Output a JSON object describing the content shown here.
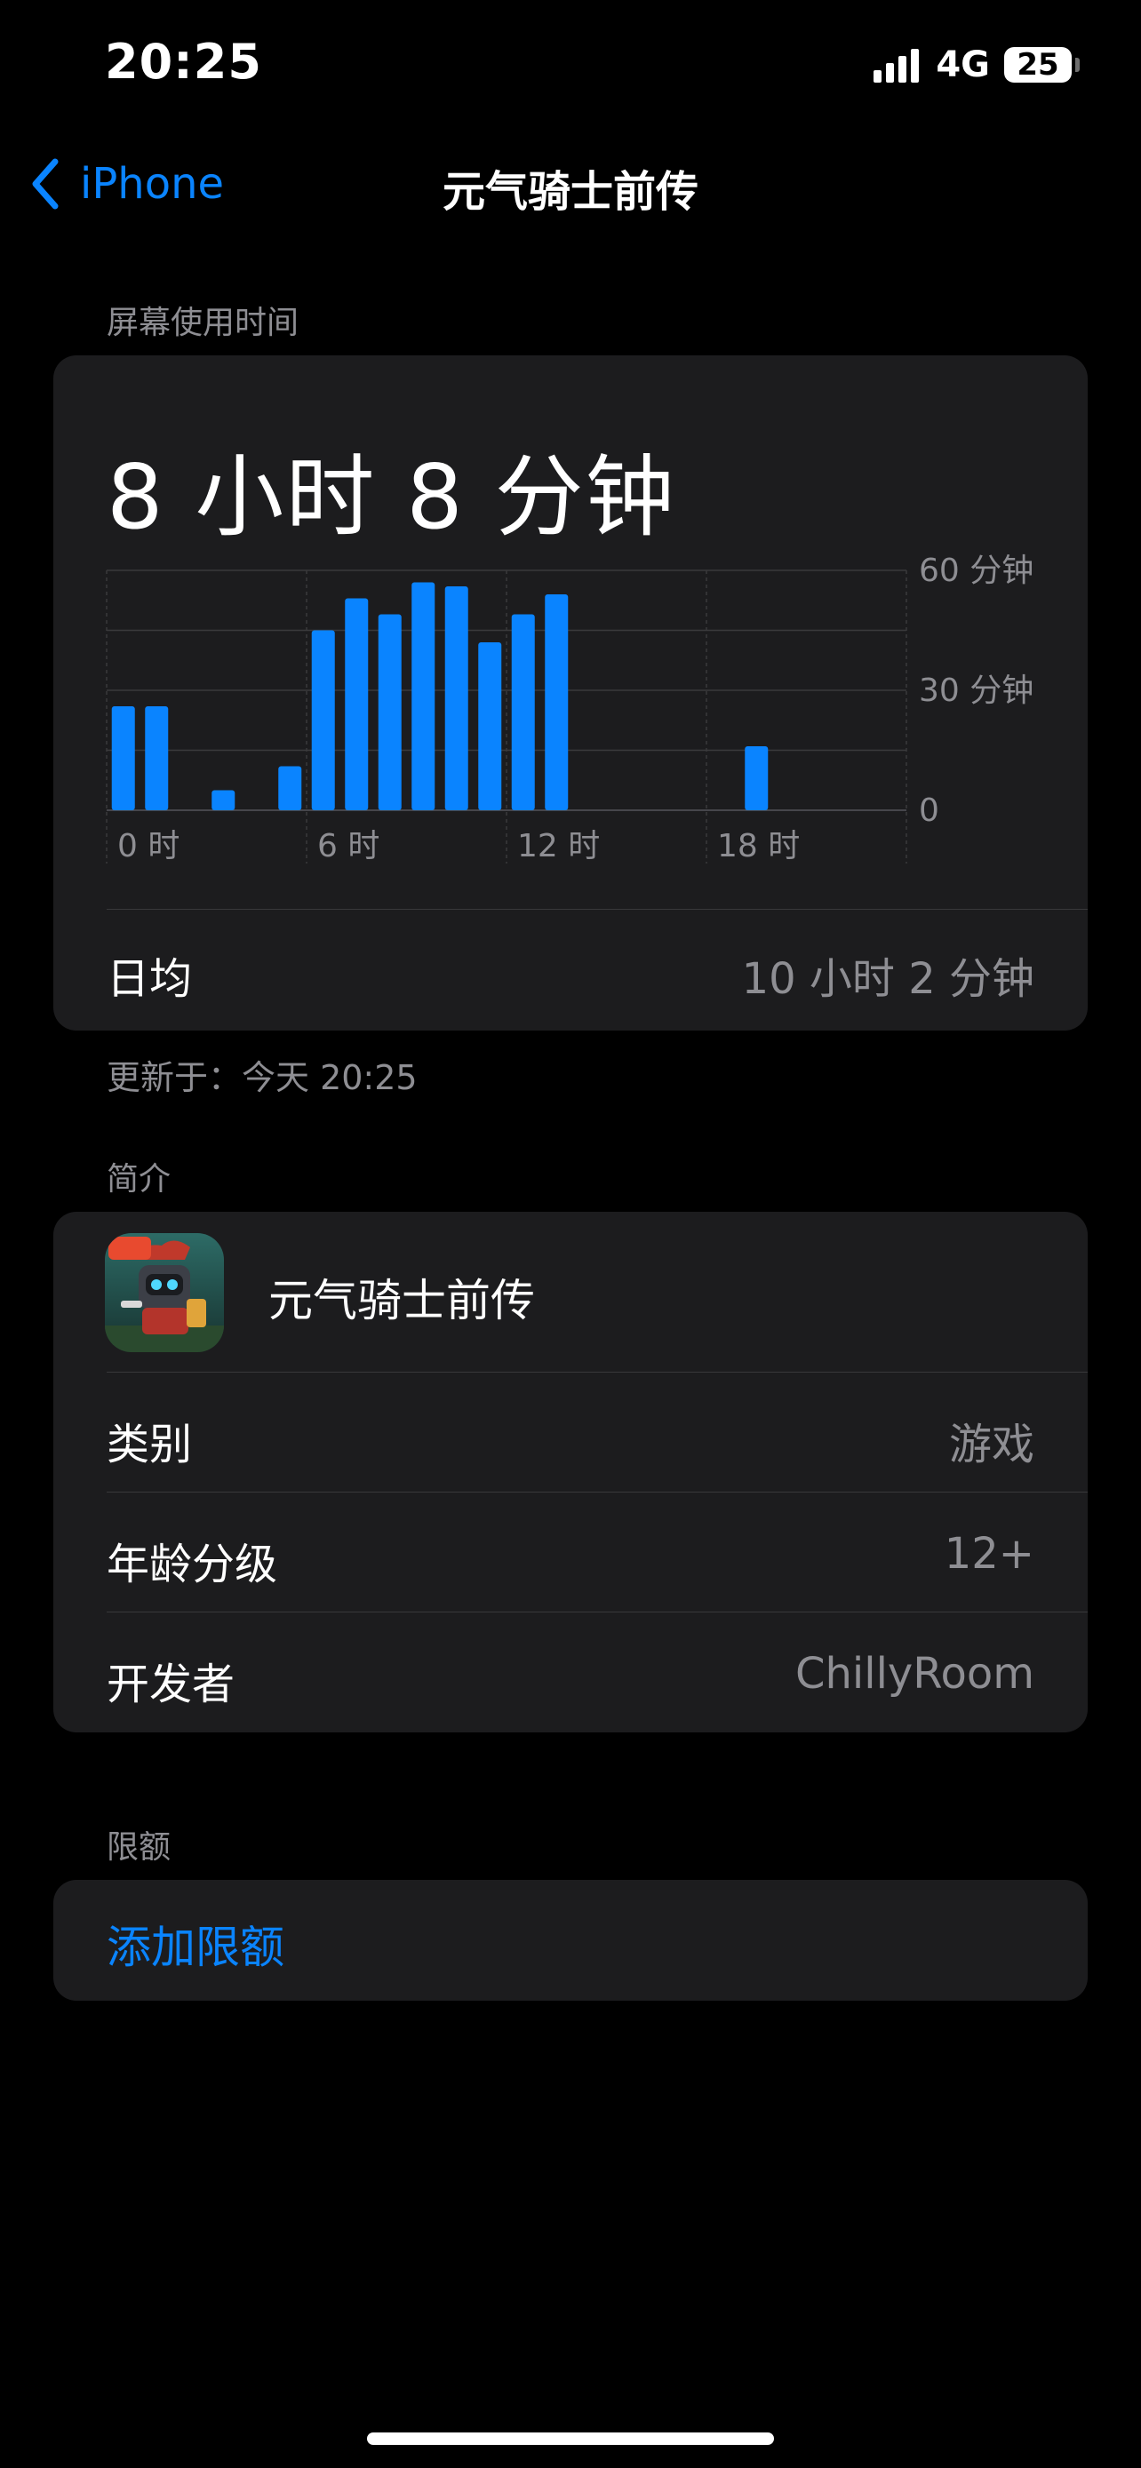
{
  "status_bar": {
    "time": "20:25",
    "network": "4G",
    "battery": "25",
    "signal_bars": 4
  },
  "nav": {
    "back_label": "iPhone",
    "title": "元气骑士前传"
  },
  "screen_time": {
    "section_title": "屏幕使用时间",
    "total": "8 小时 8 分钟",
    "daily_avg_label": "日均",
    "daily_avg_value": "10 小时 2 分钟",
    "updated": "更新于：今天 20:25"
  },
  "chart_data": {
    "type": "bar",
    "x": [
      0,
      1,
      3,
      5,
      6,
      7,
      8,
      9,
      10,
      11,
      12,
      13,
      19
    ],
    "values": [
      26,
      26,
      5,
      11,
      45,
      53,
      49,
      57,
      56,
      42,
      49,
      54,
      16
    ],
    "x_range": [
      0,
      24
    ],
    "x_tick_values": [
      0,
      6,
      12,
      18
    ],
    "x_tick_labels": [
      "0 时",
      "6 时",
      "12 时",
      "18 时"
    ],
    "ylim": [
      0,
      60
    ],
    "y_tick_values": [
      60,
      30,
      0
    ],
    "y_tick_labels": [
      "60 分钟",
      "30 分钟",
      "0"
    ],
    "title": "",
    "xlabel": "",
    "ylabel": "",
    "grid": true,
    "color": "#0a84ff"
  },
  "about": {
    "section_title": "简介",
    "app_name": "元气骑士前传",
    "icon_badge": "秘籍",
    "category_label": "类别",
    "category_value": "游戏",
    "age_label": "年龄分级",
    "age_value": "12+",
    "developer_label": "开发者",
    "developer_value": "ChillyRoom"
  },
  "limits": {
    "section_title": "限额",
    "add_label": "添加限额"
  },
  "colors": {
    "accent": "#0a84ff",
    "card": "#1c1c1e",
    "secondary_text": "#8e8e93"
  }
}
